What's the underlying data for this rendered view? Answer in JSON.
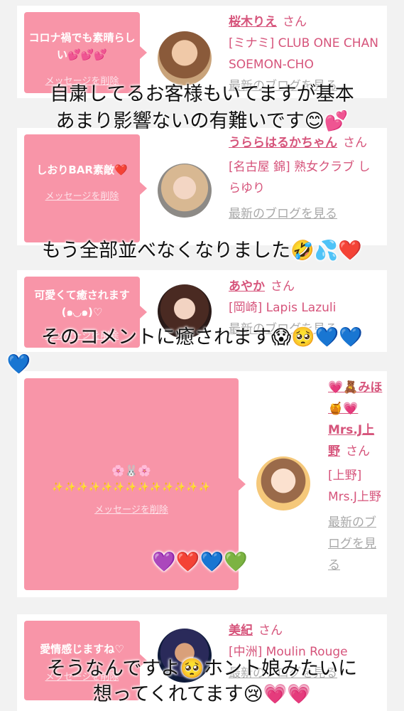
{
  "cards": [
    {
      "message": "コロナ禍でも素晴らしい💕💕💕",
      "delete": "メッセージを削除",
      "name": "桜木りえ",
      "san": "さん",
      "shop": "[ミナミ] CLUB ONE CHAN SOEMON-CHO",
      "blog": "最新のブログを見る"
    },
    {
      "message": "しおりBAR素敵❤️",
      "delete": "メッセージを削除",
      "name": "うららはるかちゃん",
      "san": "さん",
      "shop": "[名古屋 錦] 熟女クラブ しらゆり",
      "blog": "最新のブログを見る"
    },
    {
      "message": "可愛くて癒されます(๑◡๑)♡",
      "delete": "メッセージを削除",
      "name": "あやか",
      "san": "さん",
      "shop": "[岡崎] Lapis Lazuli",
      "blog": "最新のブログを見る"
    },
    {
      "message": "🌸🐰🌸",
      "message2": "✨✨✨✨✨✨✨✨✨✨✨✨✨",
      "delete": "メッセージを削除",
      "name": "💗🧸みほ🍯💗Mrs.J上野",
      "san": "さん",
      "shop": "[上野] Mrs.J上野",
      "blog": "最新のブログを見る"
    },
    {
      "message": "愛情感じますね♡",
      "delete": "メッセージを削除",
      "name": "美紀",
      "san": "さん",
      "shop": "[中洲] Moulin Rouge",
      "blog": "最新のブログを見る"
    }
  ],
  "overlays": {
    "o1a": "自粛してるお客様もいてますが基本",
    "o1b": "あまり影響ないの有難いです😊💕",
    "o2": "もう全部並べなくなりました🤣💦❤️",
    "o3a": "そのコメントに癒されます😱🥺💙💙",
    "o3b": "💙",
    "o4": "💜❤️💙💚",
    "o5a": "そうなんですよ🥺ホント娘みたいに",
    "o5b": "想ってくれてます😢💗💗"
  }
}
